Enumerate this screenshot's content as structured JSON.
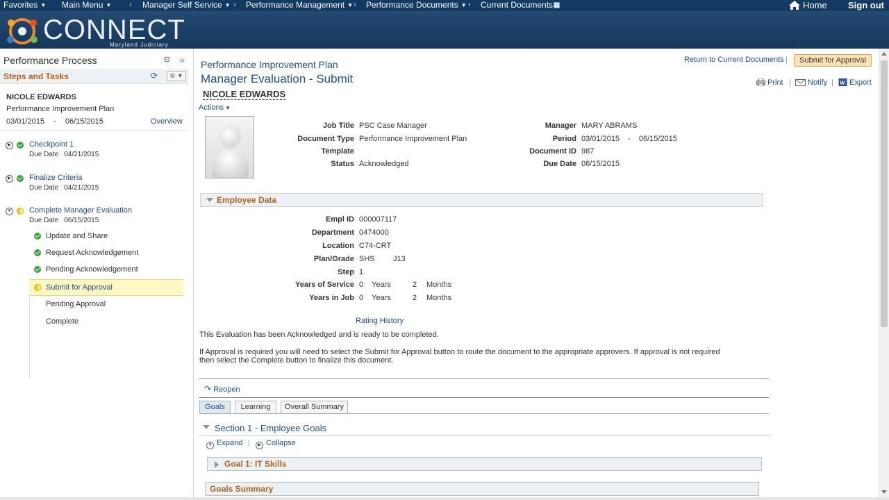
{
  "nav": {
    "favorites": "Favorites",
    "main_menu": "Main Menu",
    "manager_self_service": "Manager Self Service",
    "performance_management": "Performance Management",
    "performance_documents": "Performance Documents",
    "current_documents": "Current Documents",
    "home": "Home",
    "sign_out": "Sign out",
    "separator": "›"
  },
  "banner": {
    "logo": "CONNECT",
    "logo_sub": "Maryland Judiciary"
  },
  "left": {
    "title": "Performance Process",
    "steps_tasks": "Steps and Tasks",
    "employee": "NICOLE EDWARDS",
    "plan": "Performance Improvement Plan",
    "period_start": "03/01/2015",
    "period_sep": "-",
    "period_end": "06/15/2015",
    "overview": "Overview",
    "due_label": "Due Date",
    "steps": [
      {
        "name": "Checkpoint 1",
        "due": "04/21/2015",
        "status": "complete"
      },
      {
        "name": "Finalize Criteria",
        "due": "04/21/2015",
        "status": "complete"
      },
      {
        "name": "Complete Manager Evaluation",
        "due": "06/15/2015",
        "status": "in-progress"
      }
    ],
    "tasks": [
      {
        "name": "Update and Share",
        "status": "complete"
      },
      {
        "name": "Request Acknowledgement",
        "status": "complete"
      },
      {
        "name": "Pending Acknowledgement",
        "status": "complete"
      },
      {
        "name": "Submit for Approval",
        "status": "in-progress"
      },
      {
        "name": "Pending Approval",
        "status": "pending"
      },
      {
        "name": "Complete",
        "status": "pending"
      }
    ]
  },
  "main": {
    "title": "Performance Improvement Plan",
    "subtitle": "Manager Evaluation - Submit",
    "employee": "NICOLE EDWARDS",
    "actions": "Actions",
    "return_link": "Return to Current Documents",
    "submit_button": "Submit for Approval",
    "print": "Print",
    "notify": "Notify",
    "export": "Export",
    "pipe": "|",
    "header_fields": {
      "job_title_label": "Job Title",
      "job_title": "PSC Case Manager",
      "doc_type_label": "Document Type",
      "doc_type": "Performance Improvement Plan",
      "template_label": "Template",
      "status_label": "Status",
      "status": "Acknowledged",
      "manager_label": "Manager",
      "manager": "MARY ABRAMS",
      "period_label": "Period",
      "period_start": "03/01/2015",
      "period_sep": "-",
      "period_end": "06/15/2015",
      "doc_id_label": "Document ID",
      "doc_id": "987",
      "due_date_label": "Due Date",
      "due_date": "06/15/2015"
    },
    "employee_data": {
      "section": "Employee Data",
      "empl_id_label": "Empl ID",
      "empl_id": "000007117",
      "dept_label": "Department",
      "dept": "0474000",
      "location_label": "Location",
      "location": "C74-CRT",
      "plan_grade_label": "Plan/Grade",
      "plan": "SHS",
      "grade": "J13",
      "step_label": "Step",
      "step": "1",
      "yos_label": "Years of Service",
      "yos_years": "0",
      "yos_months": "2",
      "yij_label": "Years in Job",
      "yij_years": "0",
      "yij_months": "2",
      "years_word": "Years",
      "months_word": "Months"
    },
    "rating_history": "Rating History",
    "message1": "This Evaluation has been Acknowledged and is ready to be completed.",
    "message2": "If Approval is required you will need to select the Submit for Approval button to route the document to the appropriate approvers. If approval is not required then select the Complete button to finalize this document.",
    "reopen": "Reopen",
    "tabs": [
      "Goals",
      "Learning",
      "Overall Summary"
    ],
    "section1": "Section 1 - Employee Goals",
    "expand": "Expand",
    "collapse": "Collapse",
    "goal1": "Goal 1: IT Skills",
    "goals_summary": "Goals Summary"
  },
  "colors": {
    "nav_bg": "#123a63",
    "accent_orange": "#b4621b",
    "link_blue": "#1d4f86",
    "highlight": "#fff8c4"
  }
}
